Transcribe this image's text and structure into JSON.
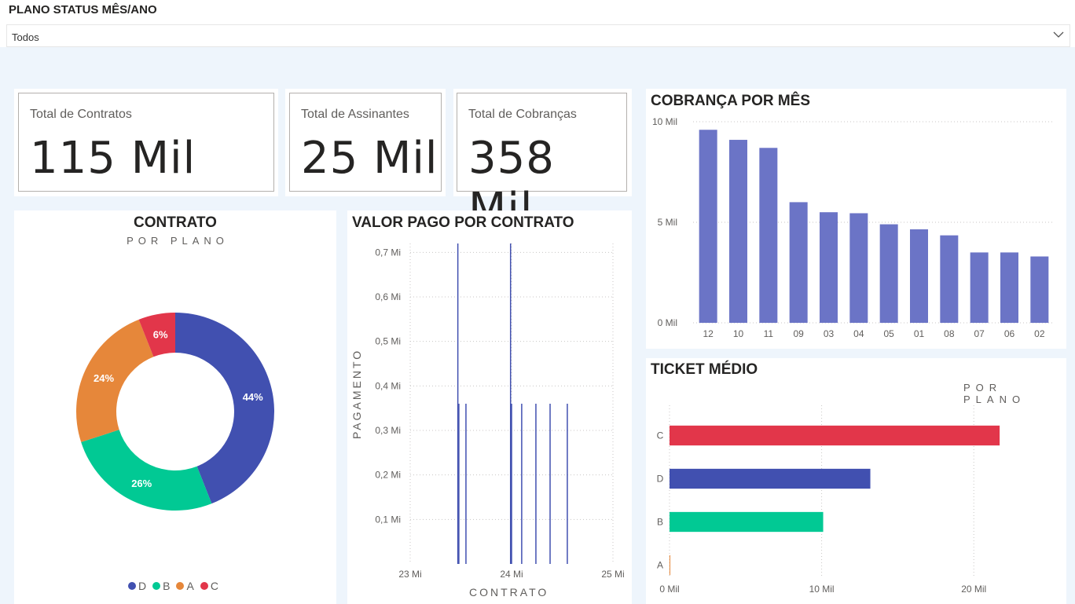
{
  "filter": {
    "title": "PLANO STATUS MÊS/ANO",
    "value": "Todos"
  },
  "kpis": [
    {
      "label": "Total de Contratos",
      "value": "115 Mil"
    },
    {
      "label": "Total de Assinantes",
      "value": "25 Mil"
    },
    {
      "label": "Total de Cobranças",
      "value": "358 Mil"
    }
  ],
  "contrato_panel": {
    "title": "CONTRATO",
    "subtitle": "POR PLANO"
  },
  "valor_panel": {
    "title": "VALOR PAGO POR CONTRATO",
    "ylabel": "PAGAMENTO",
    "xlabel": "CONTRATO"
  },
  "cobranca_panel": {
    "title": "COBRANÇA POR MÊS"
  },
  "ticket_panel": {
    "title": "TICKET MÉDIO",
    "subtitle": "POR PLANO"
  },
  "colors": {
    "D": "#4150b0",
    "B": "#01c994",
    "A": "#e6873a",
    "C": "#e2364a",
    "bar": "#6b74c6"
  },
  "chart_data": [
    {
      "id": "contrato_por_plano",
      "type": "pie",
      "title": "CONTRATO",
      "subtitle": "POR PLANO",
      "donut": true,
      "categories": [
        "D",
        "B",
        "A",
        "C"
      ],
      "values": [
        44,
        26,
        24,
        6
      ],
      "labels": [
        "44%",
        "26%",
        "24%",
        "6%"
      ],
      "legend": [
        "D",
        "B",
        "A",
        "C"
      ],
      "legend_position": "bottom"
    },
    {
      "id": "valor_pago_por_contrato",
      "type": "bar",
      "title": "VALOR PAGO POR CONTRATO",
      "xlabel": "CONTRATO",
      "ylabel": "PAGAMENTO",
      "x_ticks": [
        "23 Mi",
        "24 Mi",
        "25 Mi"
      ],
      "y_ticks": [
        "0,1 Mi",
        "0,2 Mi",
        "0,3 Mi",
        "0,4 Mi",
        "0,5 Mi",
        "0,6 Mi",
        "0,7 Mi"
      ],
      "xlim": [
        23000000,
        25000000
      ],
      "ylim": [
        0,
        0.72
      ],
      "x": [
        23470000,
        23480000,
        23550000,
        23990000,
        24000000,
        24100000,
        24240000,
        24380000,
        24550000
      ],
      "values": [
        0.72,
        0.36,
        0.36,
        0.72,
        0.36,
        0.36,
        0.36,
        0.36,
        0.36
      ],
      "grid": true
    },
    {
      "id": "cobranca_por_mes",
      "type": "bar",
      "title": "COBRANÇA POR MÊS",
      "categories": [
        "12",
        "10",
        "11",
        "09",
        "03",
        "04",
        "05",
        "01",
        "08",
        "07",
        "06",
        "02"
      ],
      "values": [
        9.6,
        9.1,
        8.7,
        6.0,
        5.5,
        5.45,
        4.9,
        4.65,
        4.35,
        3.5,
        3.5,
        3.3
      ],
      "y_ticks": [
        "0 Mil",
        "5 Mil",
        "10 Mil"
      ],
      "ylim": [
        0,
        10
      ],
      "grid": true
    },
    {
      "id": "ticket_medio",
      "type": "bar",
      "orientation": "horizontal",
      "title": "TICKET MÉDIO",
      "subtitle": "POR PLANO",
      "categories": [
        "C",
        "D",
        "B",
        "A"
      ],
      "values": [
        21.7,
        13.2,
        10.1,
        0.05
      ],
      "x_ticks": [
        "0 Mil",
        "10 Mil",
        "20 Mil"
      ],
      "xlim": [
        0,
        25
      ],
      "grid": true
    }
  ]
}
